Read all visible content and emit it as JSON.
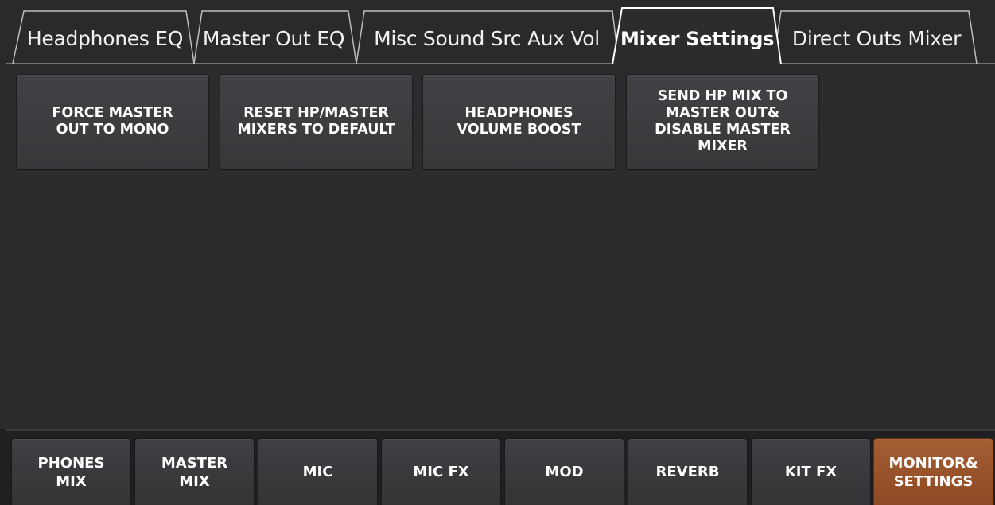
{
  "tabs": [
    {
      "label": "Headphones EQ",
      "active": false
    },
    {
      "label": "Master Out EQ",
      "active": false
    },
    {
      "label": "Misc Sound Src Aux Vol",
      "active": false
    },
    {
      "label": "Mixer Settings",
      "active": true
    },
    {
      "label": "Direct Outs Mixer",
      "active": false
    }
  ],
  "settings_buttons": [
    "FORCE MASTER\nOUT TO MONO",
    "RESET HP/MASTER\nMIXERS TO DEFAULT",
    "HEADPHONES\nVOLUME BOOST",
    "SEND HP MIX TO\nMASTER OUT&\nDISABLE MASTER\nMIXER"
  ],
  "bottom_nav": [
    {
      "label": "PHONES\nMIX",
      "active": false
    },
    {
      "label": "MASTER\nMIX",
      "active": false
    },
    {
      "label": "MIC",
      "active": false
    },
    {
      "label": "MIC FX",
      "active": false
    },
    {
      "label": "MOD",
      "active": false
    },
    {
      "label": "REVERB",
      "active": false
    },
    {
      "label": "KIT FX",
      "active": false
    },
    {
      "label": "MONITOR&\nSETTINGS",
      "active": true
    }
  ],
  "colors": {
    "background": "#2a2a2c",
    "active_nav": "#9a5430",
    "tab_outline": "#ffffff"
  }
}
